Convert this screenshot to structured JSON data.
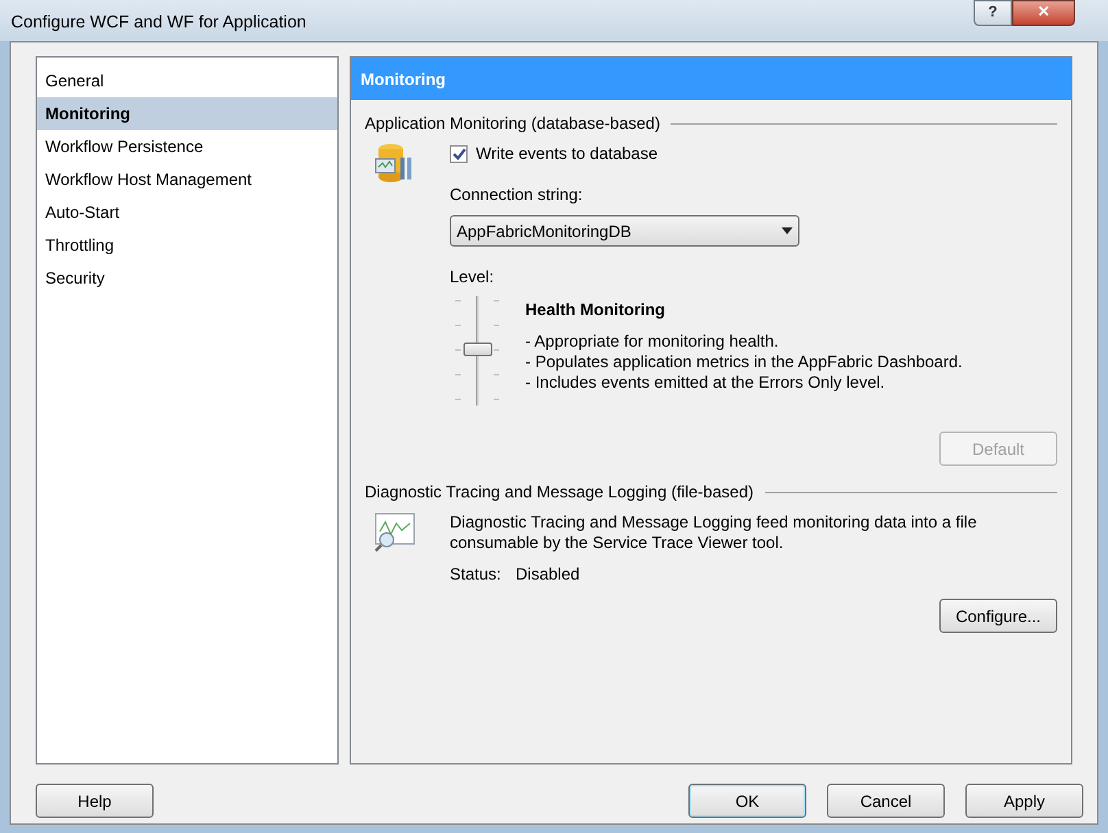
{
  "window": {
    "title": "Configure WCF and WF for Application",
    "help_glyph": "?",
    "close_glyph": "✕"
  },
  "sidebar": {
    "items": [
      {
        "label": "General",
        "selected": false
      },
      {
        "label": "Monitoring",
        "selected": true
      },
      {
        "label": "Workflow Persistence",
        "selected": false
      },
      {
        "label": "Workflow Host Management",
        "selected": false
      },
      {
        "label": "Auto-Start",
        "selected": false
      },
      {
        "label": "Throttling",
        "selected": false
      },
      {
        "label": "Security",
        "selected": false
      }
    ]
  },
  "panel": {
    "header": "Monitoring",
    "app_monitoring": {
      "title": "Application Monitoring (database-based)",
      "write_events": {
        "label": "Write events to database",
        "checked": true
      },
      "connection_label": "Connection string:",
      "connection_value": "AppFabricMonitoringDB",
      "level_label": "Level:",
      "level": {
        "level": 0.5
      },
      "level_title": "Health Monitoring",
      "level_lines": [
        "- Appropriate for monitoring health.",
        "- Populates application metrics in the AppFabric Dashboard.",
        "- Includes events emitted at the Errors Only level."
      ],
      "default_button": {
        "label": "Default",
        "disabled": true
      }
    },
    "diagnostic": {
      "title": "Diagnostic Tracing and Message Logging (file-based)",
      "description": "Diagnostic Tracing and Message Logging feed monitoring data into a file consumable by the Service Trace Viewer tool.",
      "status_label": "Status:",
      "status_value": "Disabled",
      "configure_button": "Configure..."
    }
  },
  "buttons": {
    "help": "Help",
    "ok": "OK",
    "cancel": "Cancel",
    "apply": "Apply"
  }
}
